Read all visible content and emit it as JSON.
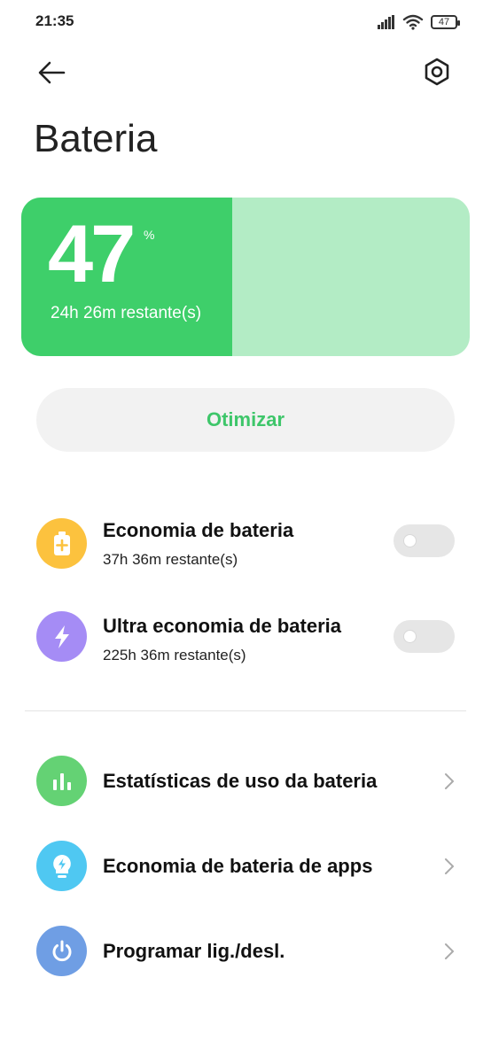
{
  "status_bar": {
    "time": "21:35",
    "battery_level": "47",
    "icons": [
      "signal-icon",
      "wifi-icon",
      "battery-icon"
    ]
  },
  "header": {
    "back_icon": "arrow-left-icon",
    "settings_icon": "hexagon-gear-icon",
    "title": "Bateria"
  },
  "battery": {
    "percent": "47",
    "percent_sign": "%",
    "level_fraction": 0.47,
    "remaining": "24h 26m restante(s)",
    "fill_color": "#3ecf6a",
    "track_color": "#b3ecc5"
  },
  "optimize_button": {
    "label": "Otimizar",
    "color": "#3ec66a"
  },
  "saver_modes": [
    {
      "title": "Economia de bateria",
      "subtitle": "37h 36m restante(s)",
      "icon": "battery-plus-icon",
      "icon_color": "#fcc23e",
      "enabled": false
    },
    {
      "title": "Ultra economia de bateria",
      "subtitle": "225h 36m restante(s)",
      "icon": "lightning-icon",
      "icon_color": "#a58cf5",
      "enabled": false
    }
  ],
  "menu_items": [
    {
      "title": "Estatísticas de uso da bateria",
      "icon": "bar-chart-icon",
      "icon_color": "#64d274"
    },
    {
      "title": "Economia de bateria de apps",
      "icon": "lightbulb-bolt-icon",
      "icon_color": "#4fc8f2"
    },
    {
      "title": "Programar lig./desl.",
      "icon": "power-icon",
      "icon_color": "#6f9ee4"
    }
  ]
}
